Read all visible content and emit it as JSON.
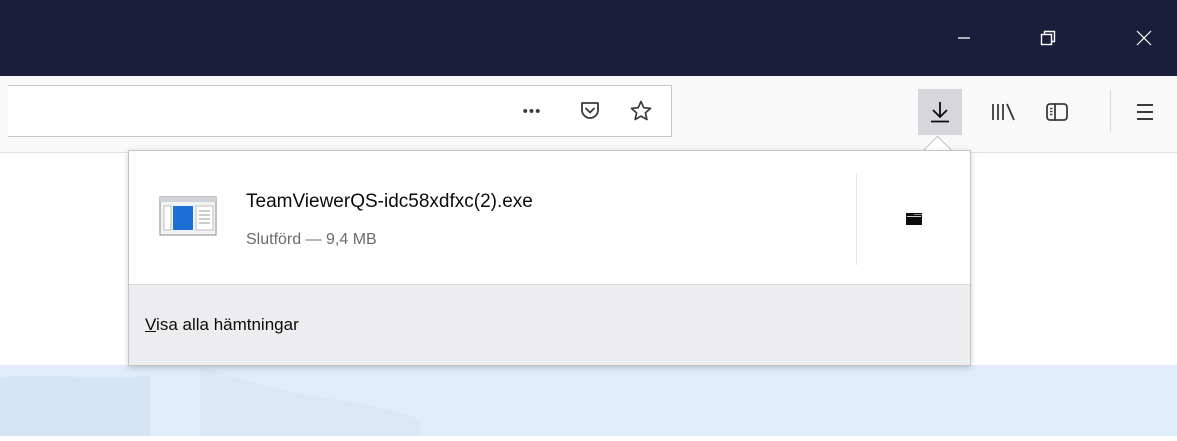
{
  "window": {
    "minimize_icon": "minimize-icon",
    "restore_icon": "restore-icon",
    "close_icon": "close-icon"
  },
  "urlbar": {
    "page_actions_label": "•••",
    "pocket_icon": "pocket-icon",
    "bookmark_icon": "star-icon"
  },
  "toolbar": {
    "downloads_icon": "download-arrow-icon",
    "library_icon": "library-icon",
    "sidebar_icon": "sidebar-icon",
    "menu_icon": "hamburger-menu-icon"
  },
  "downloads_panel": {
    "items": [
      {
        "filename": "TeamViewerQS-idc58xdfxc(2).exe",
        "status": "Slutförd — 9,4 MB",
        "file_icon": "executable-file-icon",
        "action_icon": "open-folder-icon"
      }
    ],
    "footer": {
      "accesskey": "V",
      "label_rest": "isa alla hämtningar"
    }
  },
  "colors": {
    "titlebar": "#1b1e3b",
    "toolbar": "#f9f9fa",
    "panel_footer": "#ededf0",
    "file_icon_blue": "#1d6fd6"
  }
}
